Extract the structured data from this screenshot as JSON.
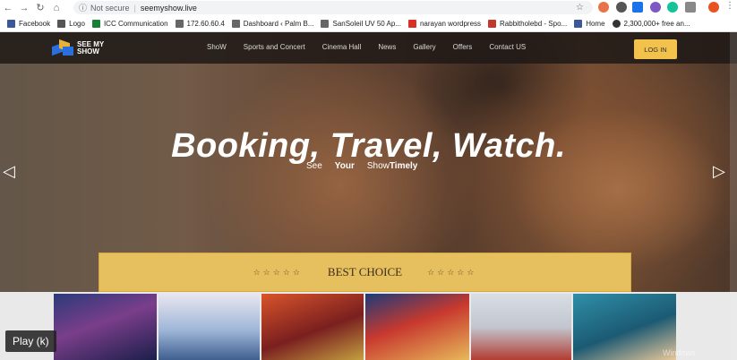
{
  "browser": {
    "url_host": "seemyshow.live",
    "not_secure": "Not secure",
    "bookmarks": [
      {
        "label": "Facebook",
        "color": "#3b5998"
      },
      {
        "label": "Logo",
        "color": "#555555"
      },
      {
        "label": "ICC Communication",
        "color": "#1a7f37"
      },
      {
        "label": "172.60.60.4",
        "color": "#666666"
      },
      {
        "label": "Dashboard ‹ Palm B...",
        "color": "#666666"
      },
      {
        "label": "SanSoleil UV 50 Ap...",
        "color": "#666666"
      },
      {
        "label": "narayan wordpress",
        "color": "#d93025"
      },
      {
        "label": "Rabbitholebd - Spo...",
        "color": "#c0392b"
      },
      {
        "label": "Home",
        "color": "#3b5998"
      },
      {
        "label": "2,300,000+ free an...",
        "color": "#333333"
      }
    ]
  },
  "site": {
    "logo_line1": "SEE MY",
    "logo_line2": "SHOW",
    "nav": [
      "ShoW",
      "Sports and Concert",
      "Cinema Hall",
      "News",
      "Gallery",
      "Offers",
      "Contact US"
    ],
    "login_label": "LOG IN",
    "headline": "Booking, Travel, Watch.",
    "subline": [
      "See",
      "Your",
      "Show",
      "Timely"
    ],
    "best_choice": "BEST CHOICE",
    "stars": "☆☆☆☆☆",
    "prev_arrow": "◁",
    "next_arrow": "▷"
  },
  "overlay": {
    "play_label": "Play (k)",
    "watermark": "Windows"
  },
  "colors": {
    "accent": "#f2c24c",
    "best_bg": "#e6bf5f"
  }
}
